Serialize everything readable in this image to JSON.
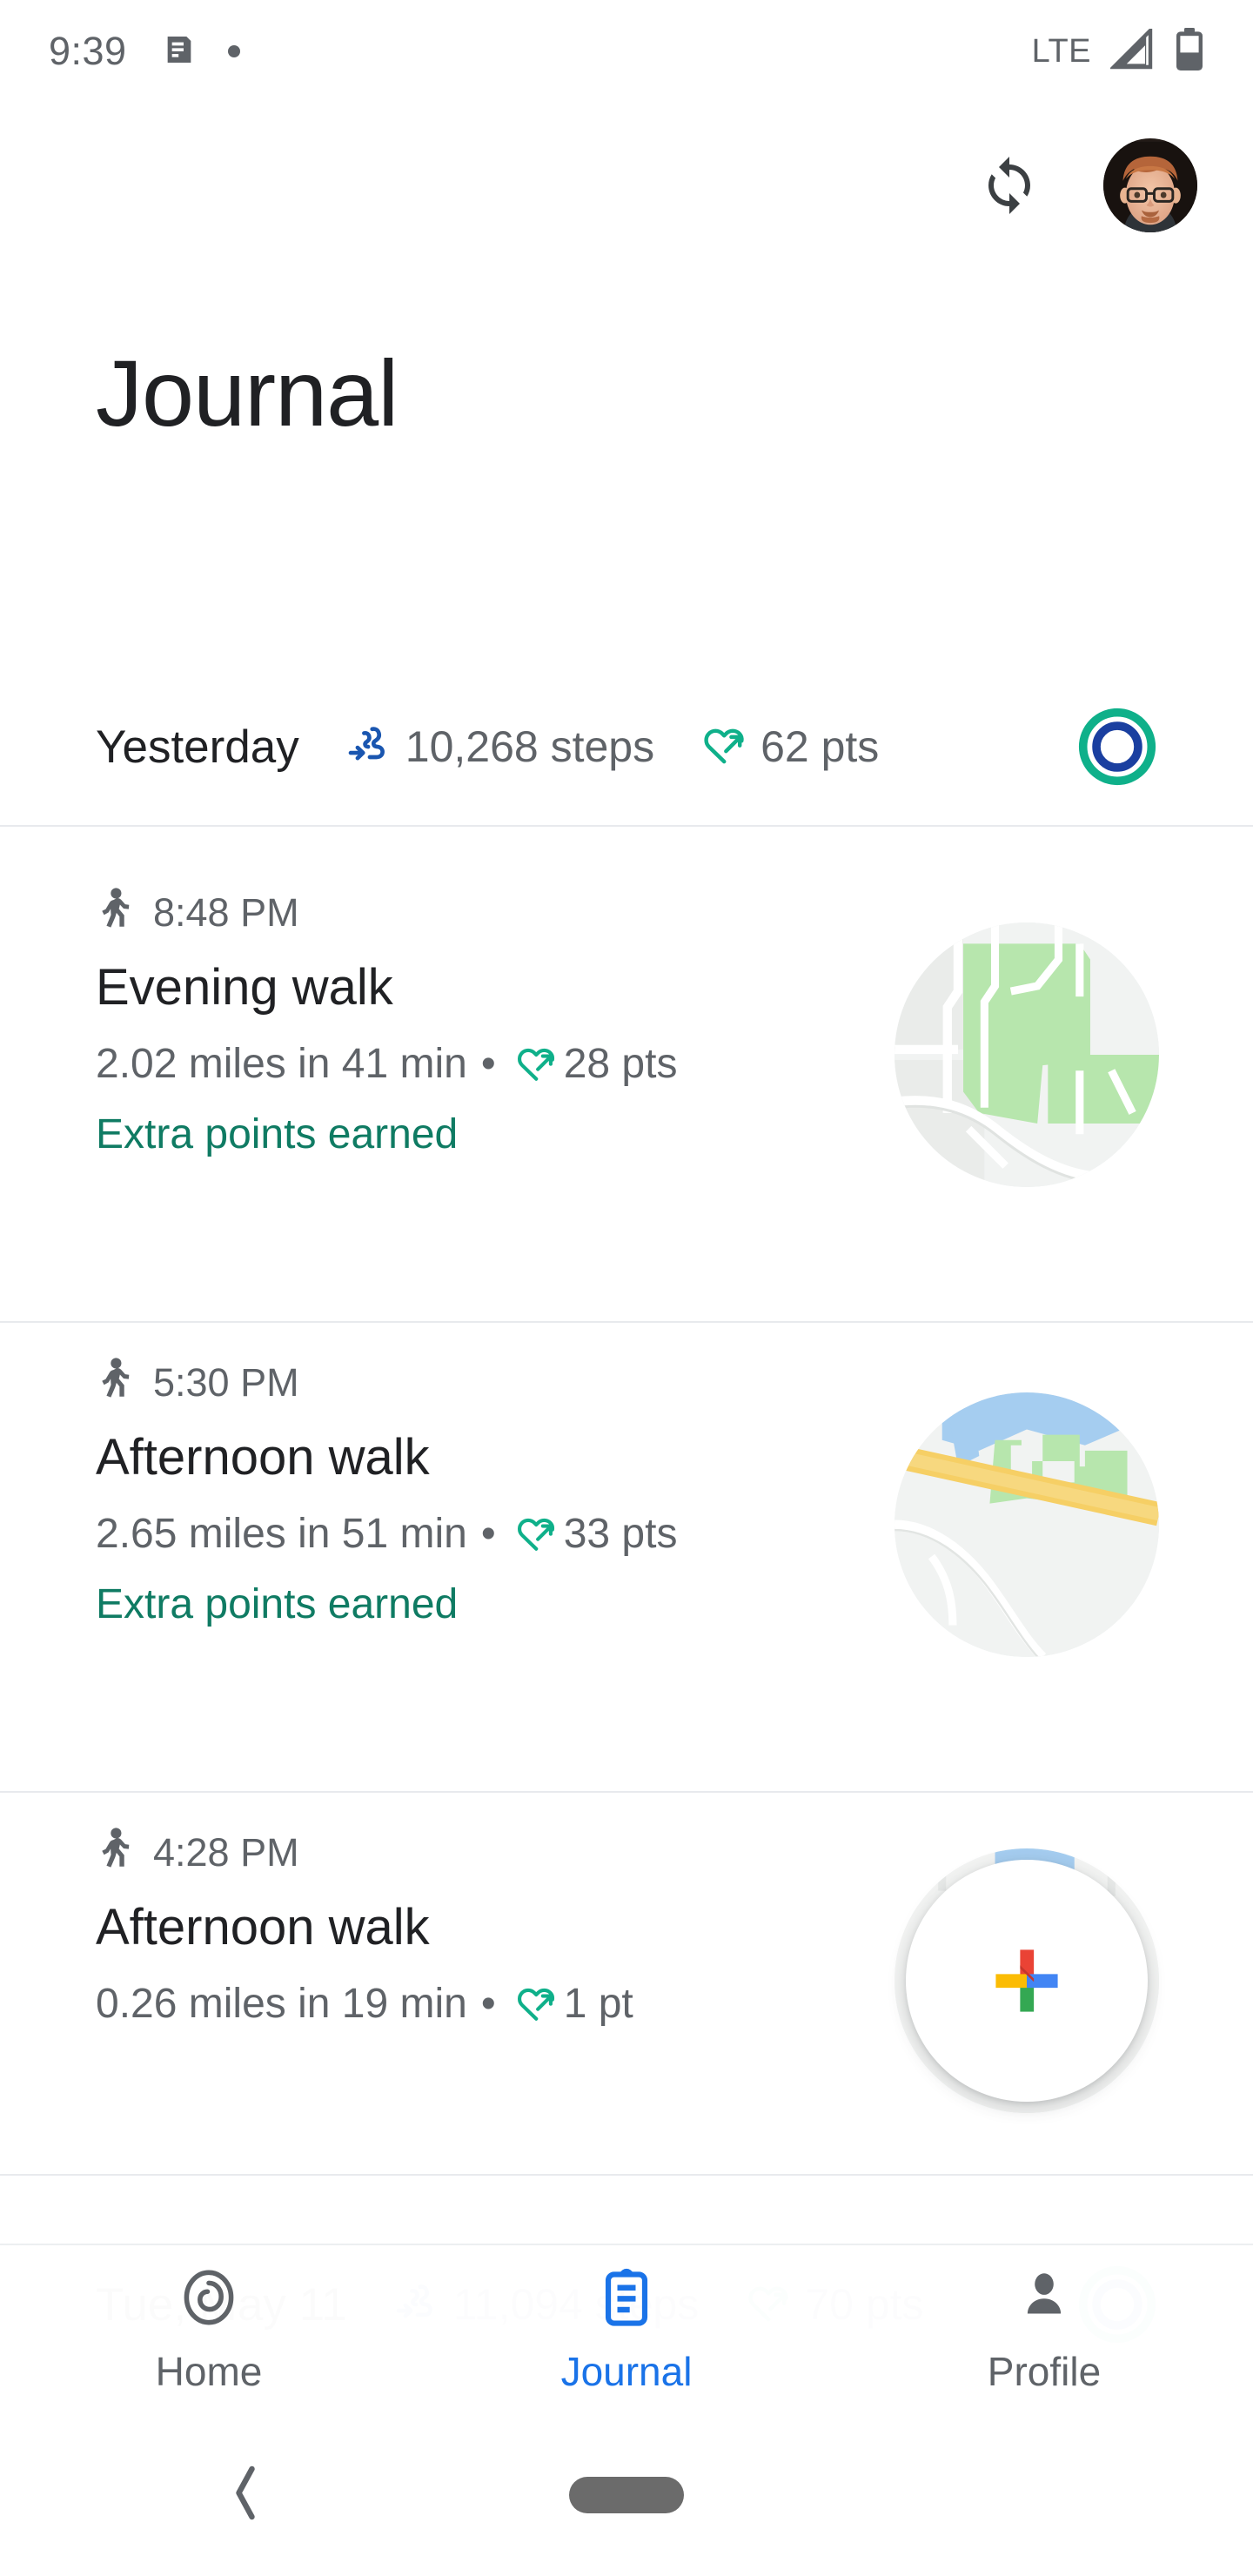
{
  "status_bar": {
    "time": "9:39",
    "message_icon": "message-icon",
    "dot_icon": "notification-dot",
    "network": "LTE",
    "signal_icon": "signal-triangle-icon",
    "battery_icon": "battery-icon"
  },
  "app_bar": {
    "sync_icon": "sync-icon",
    "avatar": "profile-avatar"
  },
  "header": {
    "title": "Journal"
  },
  "day_summary": {
    "label": "Yesterday",
    "steps_icon": "footprints-icon",
    "steps": "10,268 steps",
    "points_icon": "heart-points-icon",
    "points": "62 pts",
    "goal_rings_icon": "goal-rings-icon"
  },
  "entries": [
    {
      "activity_icon": "walking-person-icon",
      "time": "8:48 PM",
      "title": "Evening walk",
      "distance_duration": "2.02 miles in 41 min",
      "separator": "•",
      "points_icon": "heart-points-icon",
      "points": "28 pts",
      "extra": "Extra points earned",
      "thumbnail": "map-thumbnail-park"
    },
    {
      "activity_icon": "walking-person-icon",
      "time": "5:30 PM",
      "title": "Afternoon walk",
      "distance_duration": "2.65 miles in 51 min",
      "separator": "•",
      "points_icon": "heart-points-icon",
      "points": "33 pts",
      "extra": "Extra points earned",
      "thumbnail": "map-thumbnail-highway"
    },
    {
      "activity_icon": "walking-person-icon",
      "time": "4:28 PM",
      "title": "Afternoon walk",
      "distance_duration": "0.26 miles in 19 min",
      "separator": "•",
      "points_icon": "heart-points-icon",
      "points": "1 pt",
      "extra": "",
      "thumbnail": "google-fit-plus-badge"
    }
  ],
  "next_day_preview": {
    "label": "Tue, May 11",
    "steps_icon": "footprints-icon",
    "steps": "11,094 steps",
    "points_icon": "heart-points-icon",
    "points": "70 pts",
    "goal_rings_icon": "goal-rings-icon"
  },
  "bottom_nav": {
    "items": [
      {
        "label": "Home",
        "icon": "home-rings-icon",
        "active": false
      },
      {
        "label": "Journal",
        "icon": "clipboard-icon",
        "active": true
      },
      {
        "label": "Profile",
        "icon": "person-icon",
        "active": false
      }
    ]
  },
  "gesture_bar": {
    "back_icon": "back-chevron-icon",
    "home_indicator": "home-pill-indicator"
  },
  "colors": {
    "accent_blue": "#1a73e8",
    "steps_blue": "#1a56b0",
    "heart_teal": "#0fb08a",
    "extra_green": "#0f7b63",
    "text_primary": "#202124",
    "text_secondary": "#5f6368"
  }
}
